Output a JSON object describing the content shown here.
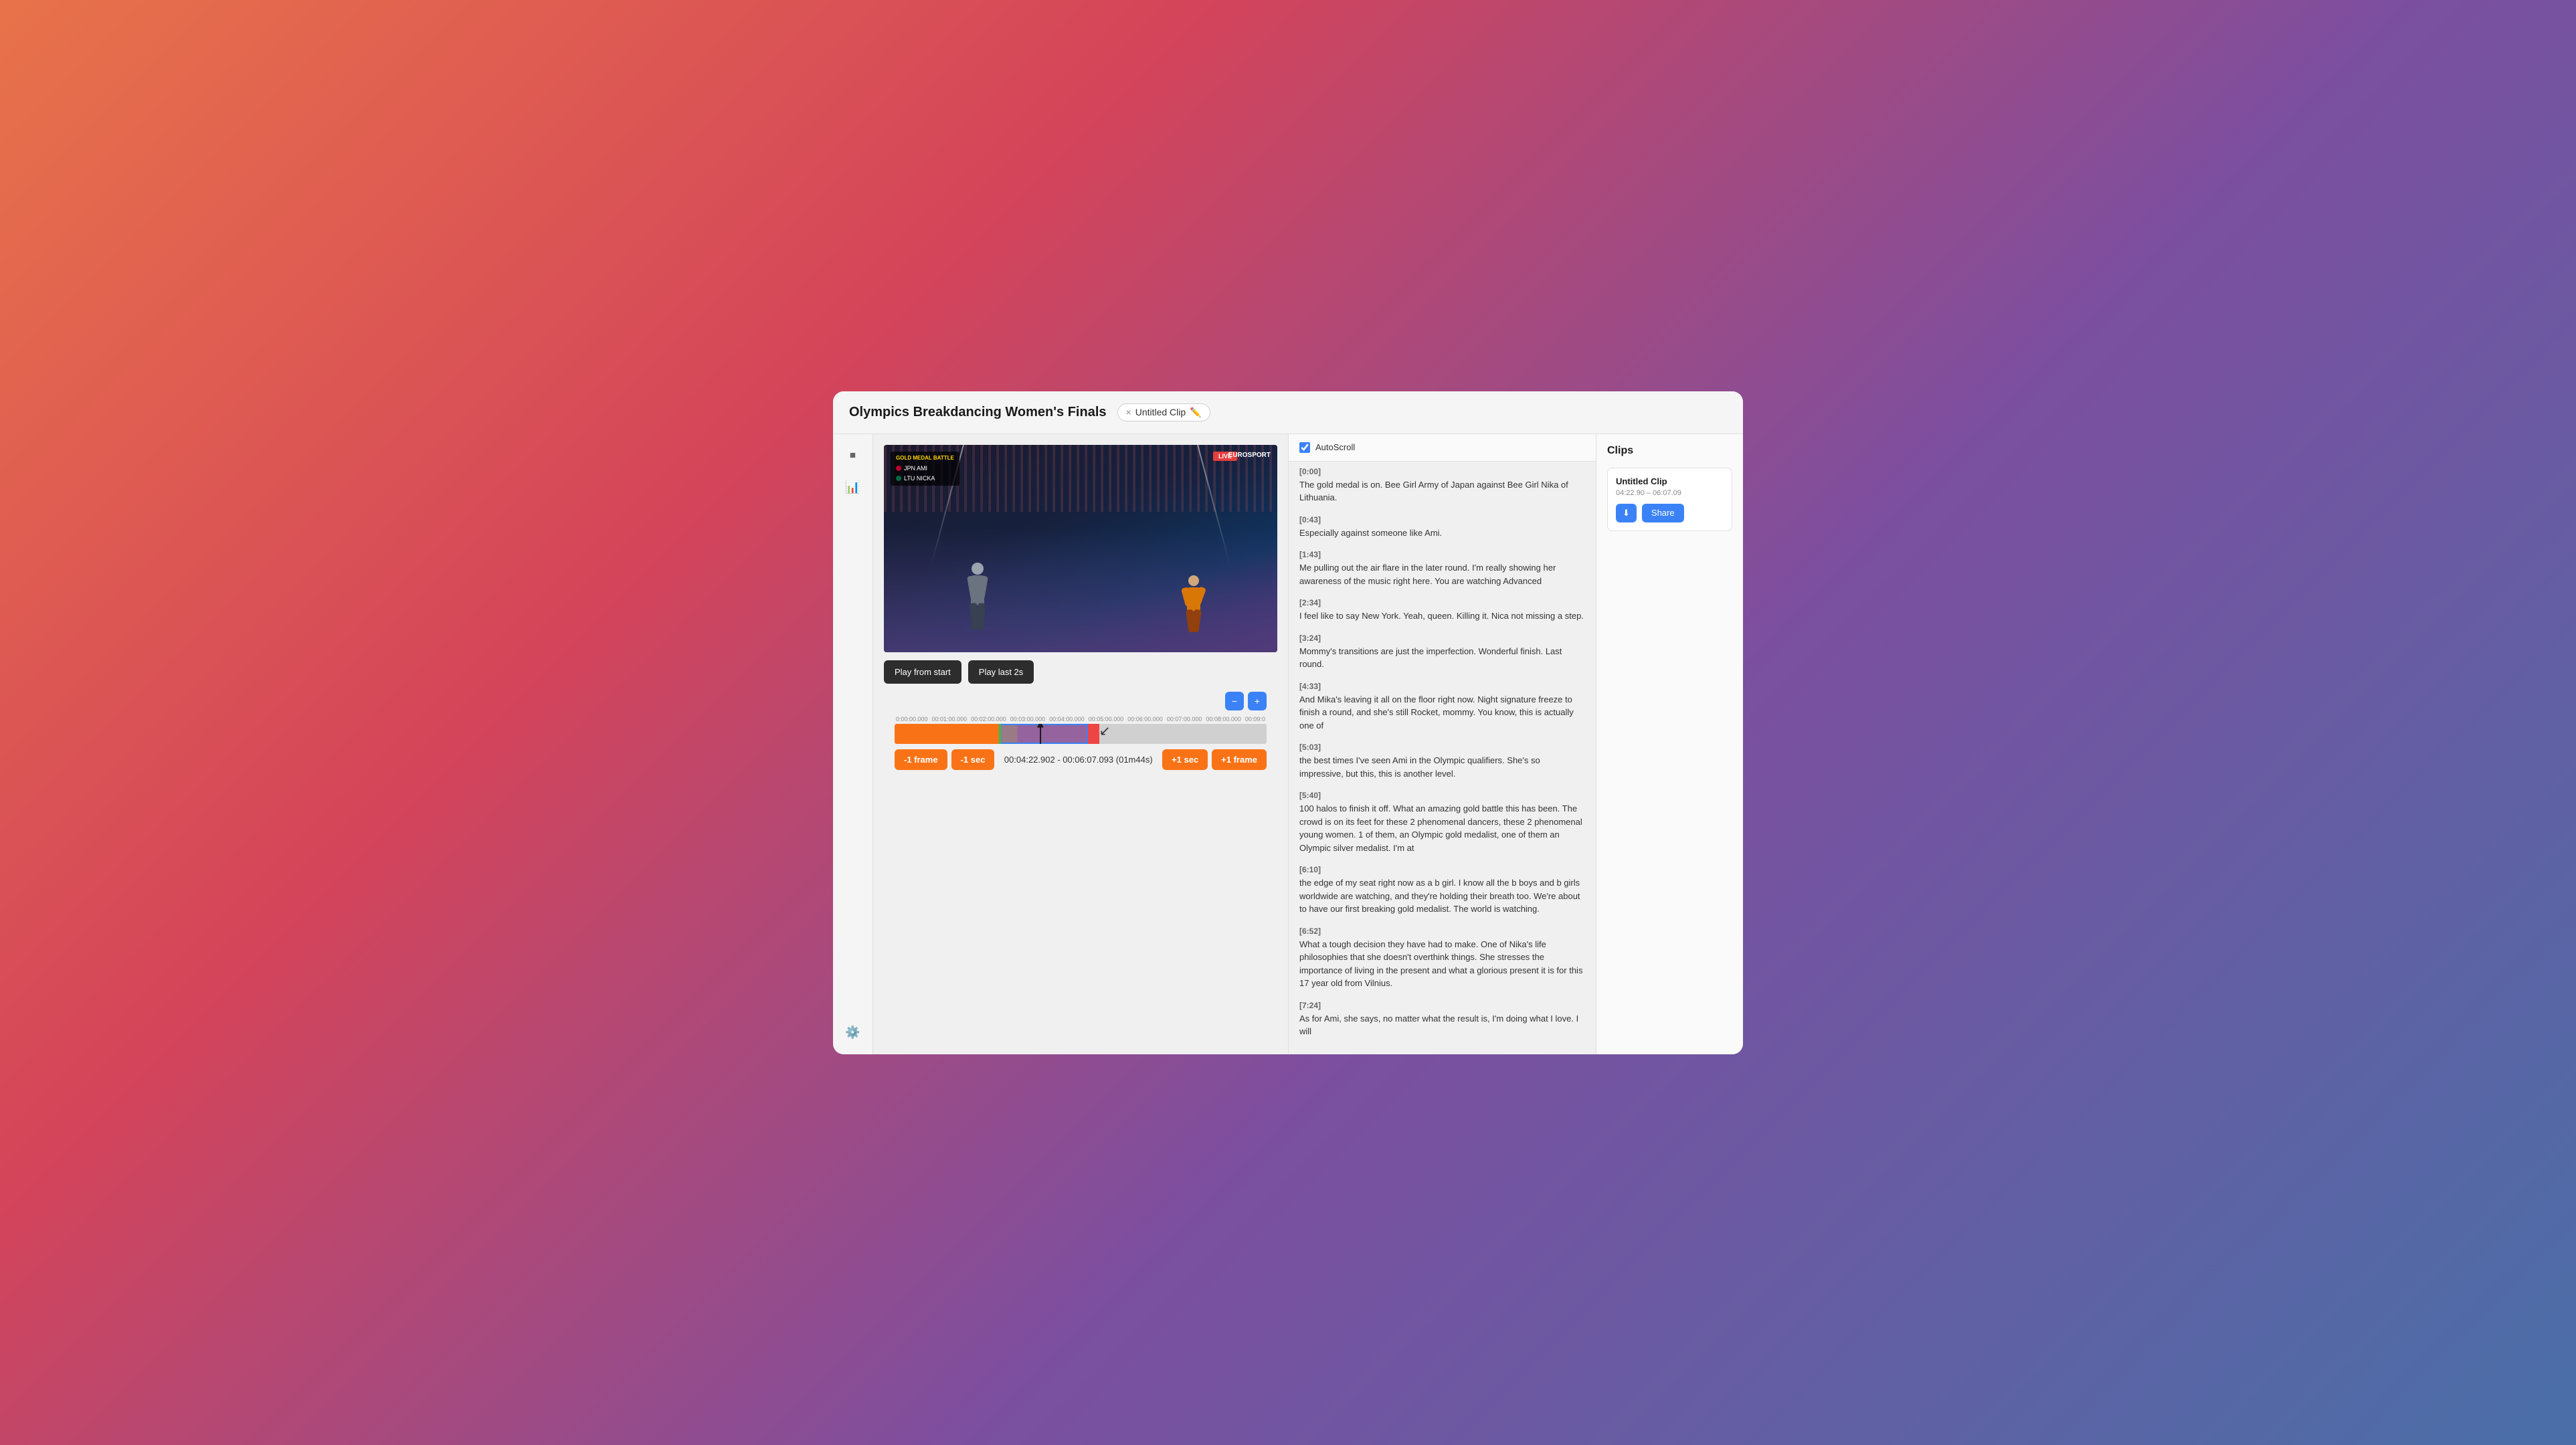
{
  "header": {
    "title": "Olympics Breakdancing Women's Finals",
    "clip_name": "Untitled Clip",
    "clip_close": "×"
  },
  "autoscroll": {
    "label": "AutoScroll",
    "checked": true
  },
  "controls": {
    "play_from_start": "Play from start",
    "play_last": "Play last 2s",
    "minus_frame": "-1 frame",
    "minus_sec": "-1 sec",
    "plus_sec": "+1 sec",
    "plus_frame": "+1 frame",
    "timecode": "00:04:22.902 - 00:06:07.093 (01m44s)"
  },
  "timeline": {
    "labels": [
      "0:00:00.000",
      "00:01:00.000",
      "00:02:00.000",
      "00:03:00.000",
      "00:04:00.000",
      "00:05:00.000",
      "00:06:00.000",
      "00:07:00.000",
      "00:08:00.000",
      "00:09:0"
    ]
  },
  "transcript": {
    "entries": [
      {
        "timestamp": "[0:00]",
        "text": "The gold medal is on. Bee Girl Army of Japan against Bee Girl Nika of Lithuania."
      },
      {
        "timestamp": "[0:43]",
        "text": "Especially against someone like Ami."
      },
      {
        "timestamp": "[1:43]",
        "text": "Me pulling out the air flare in the later round. I'm really showing her awareness of the music right here. You are watching Advanced"
      },
      {
        "timestamp": "[2:34]",
        "text": "I feel like to say New York. Yeah, queen. Killing it. Nica not missing a step."
      },
      {
        "timestamp": "[3:24]",
        "text": "Mommy's transitions are just the imperfection. Wonderful finish. Last round."
      },
      {
        "timestamp": "[4:33]",
        "text": "And Mika's leaving it all on the floor right now. Night signature freeze to finish a round, and she's still Rocket, mommy. You know, this is actually one of"
      },
      {
        "timestamp": "[5:03]",
        "text": "the best times I've seen Ami in the Olympic qualifiers. She's so impressive, but this, this is another level."
      },
      {
        "timestamp": "[5:40]",
        "text": "100 halos to finish it off. What an amazing gold battle this has been. The crowd is on its feet for these 2 phenomenal dancers, these 2 phenomenal young women. 1 of them, an Olympic gold medalist, one of them an Olympic silver medalist. I'm at"
      },
      {
        "timestamp": "[6:10]",
        "text": "the edge of my seat right now as a b girl. I know all the b boys and b girls worldwide are watching, and they're holding their breath too. We're about to have our first breaking gold medalist. The world is watching."
      },
      {
        "timestamp": "[6:52]",
        "text": "What a tough decision they have had to make. One of Nika's life philosophies that she doesn't overthink things. She stresses the importance of living in the present and what a glorious present it is for this 17 year old from Vilnius."
      },
      {
        "timestamp": "[7:24]",
        "text": "As for Ami, she says, no matter what the result is, I'm doing what I love. I will"
      }
    ]
  },
  "clips_panel": {
    "title": "Clips",
    "clip": {
      "name": "Untitled Clip",
      "timerange": "04:22.90 – 06:07.09",
      "download_label": "⬇",
      "share_label": "Share"
    }
  },
  "scoreboard": {
    "title": "GOLD MEDAL BATTLE",
    "team1": "JPN  AMI",
    "team2": "LTU  NICKA"
  },
  "live_badge": "LIVE",
  "broadcaster": "EUROSPORT"
}
